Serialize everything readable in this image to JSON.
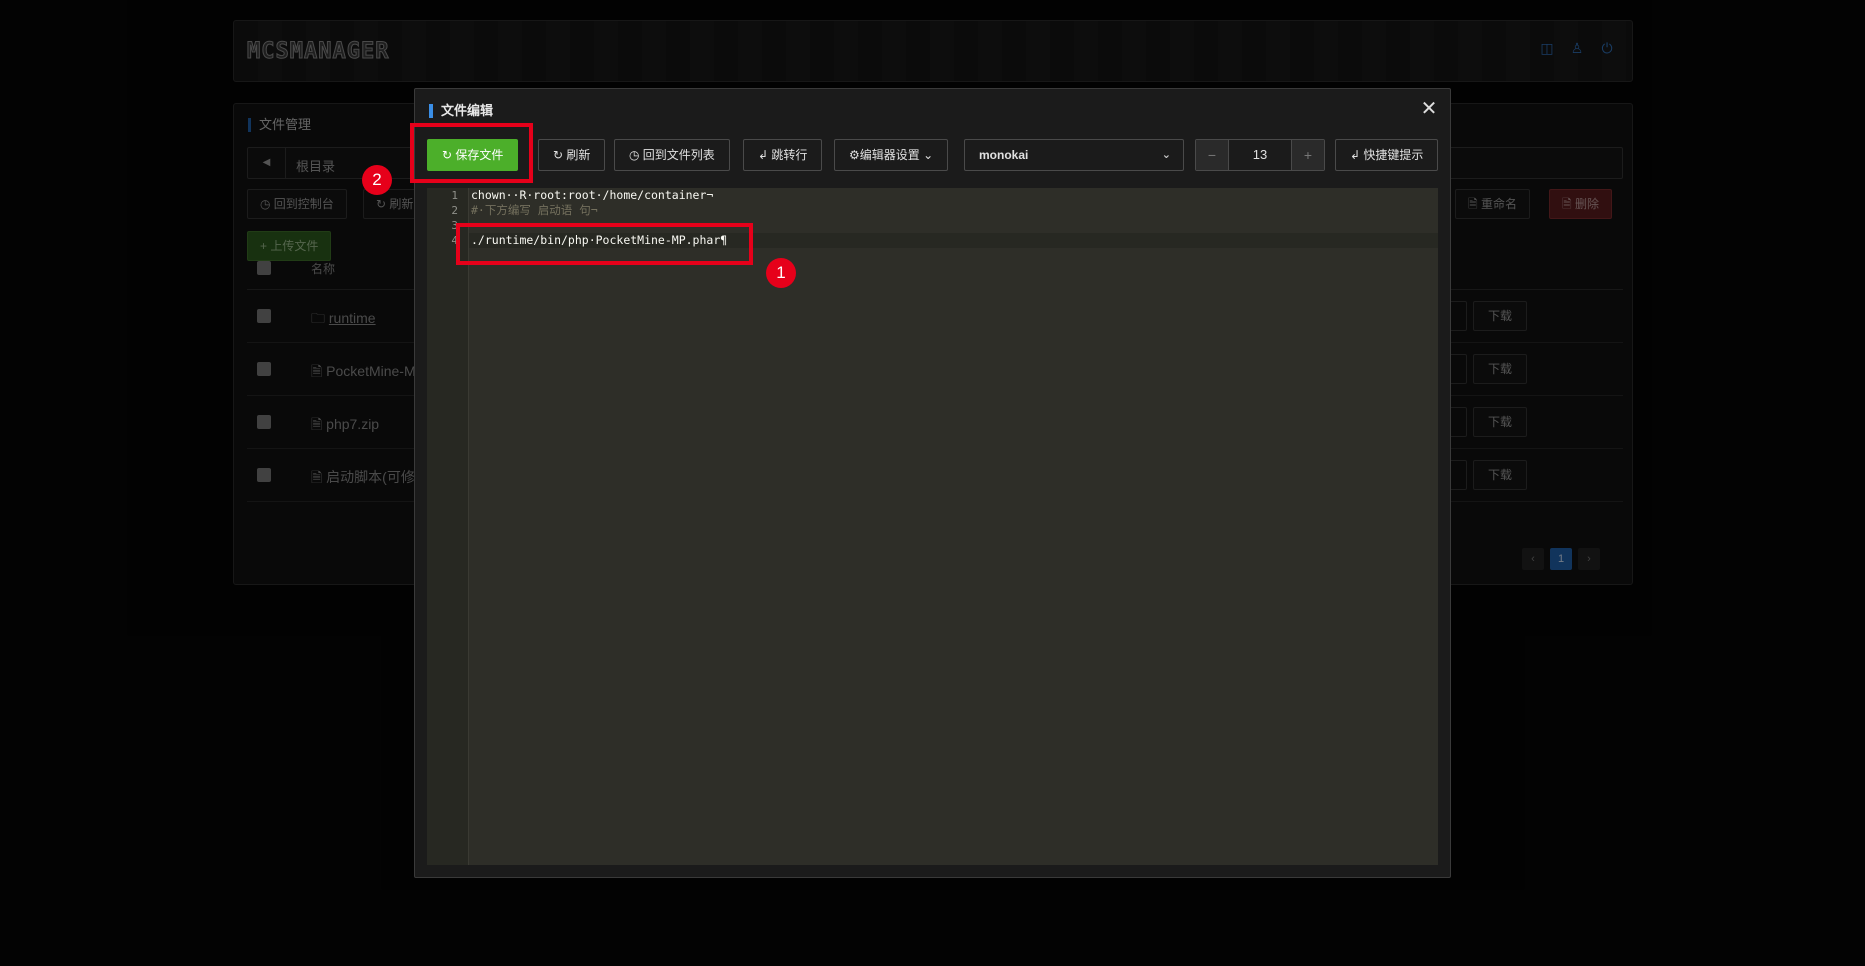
{
  "header": {
    "logo": "MCSMANAGER",
    "icons": [
      "chat-icon",
      "user-icon",
      "power-icon"
    ]
  },
  "file_manager": {
    "title": "文件管理",
    "path": "根目录",
    "back_to_console": "◷ 回到控制台",
    "refresh": "↻ 刷新",
    "rename": "🗎 重命名",
    "delete": "🗎 删除",
    "upload": "+ 上传文件",
    "column_name": "名称",
    "rows": [
      {
        "icon": "🗀",
        "name": "runtime",
        "download": "下载"
      },
      {
        "icon": "🗎",
        "name": "PocketMine-M",
        "download": "下载"
      },
      {
        "icon": "🗎",
        "name": "php7.zip",
        "download": "下载"
      },
      {
        "icon": "🗎",
        "name": "启动脚本(可修",
        "download": "下载"
      }
    ],
    "pagination": {
      "prev": "‹",
      "current": "1",
      "next": "›"
    }
  },
  "editor_modal": {
    "title": "文件编辑",
    "save": "↻ 保存文件",
    "refresh": "↻ 刷新",
    "back_to_list": "◷ 回到文件列表",
    "goto_line": "↲ 跳转行",
    "editor_settings": "⚙编辑器设置",
    "theme": "monokai",
    "font_size": "13",
    "shortcuts": "↲ 快捷键提示",
    "close": "✕",
    "lines": [
      {
        "num": "1",
        "text": "chown··R·root:root·/home/container¬"
      },
      {
        "num": "2",
        "text": "#·下方编写 启动语 句¬"
      },
      {
        "num": "3",
        "text": "¬"
      },
      {
        "num": "4",
        "text": "./runtime/bin/php·PocketMine-MP.phar¶"
      }
    ]
  },
  "annotations": {
    "badge_1": "1",
    "badge_2": "2",
    "color": "#e6001a"
  },
  "colors": {
    "accent": "#3a8ee6",
    "save_green": "#4caf2a",
    "delete_red": "#5a1c1e",
    "editor_bg": "#272822"
  }
}
